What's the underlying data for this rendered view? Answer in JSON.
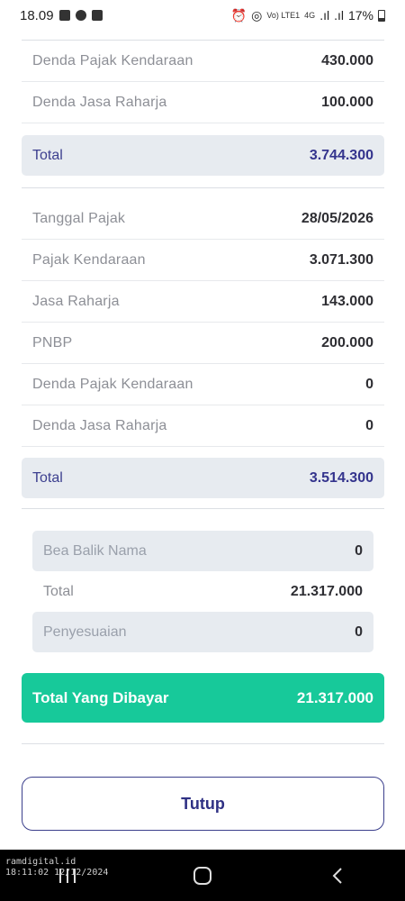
{
  "status_bar": {
    "time": "18.09",
    "network": "4G",
    "battery": "17%"
  },
  "section1": {
    "rows": [
      {
        "label": "Denda Pajak Kendaraan",
        "value": "430.000"
      },
      {
        "label": "Denda Jasa Raharja",
        "value": "100.000"
      }
    ],
    "total": {
      "label": "Total",
      "value": "3.744.300"
    }
  },
  "section2": {
    "rows": [
      {
        "label": "Tanggal Pajak",
        "value": "28/05/2026"
      },
      {
        "label": "Pajak Kendaraan",
        "value": "3.071.300"
      },
      {
        "label": "Jasa Raharja",
        "value": "143.000"
      },
      {
        "label": "PNBP",
        "value": "200.000"
      },
      {
        "label": "Denda Pajak Kendaraan",
        "value": "0"
      },
      {
        "label": "Denda Jasa Raharja",
        "value": "0"
      }
    ],
    "total": {
      "label": "Total",
      "value": "3.514.300"
    }
  },
  "summary": {
    "bea_balik_nama": {
      "label": "Bea Balik Nama",
      "value": "0"
    },
    "total": {
      "label": "Total",
      "value": "21.317.000"
    },
    "penyesuaian": {
      "label": "Penyesuaian",
      "value": "0"
    }
  },
  "grand_total": {
    "label": "Total Yang Dibayar",
    "value": "21.317.000"
  },
  "close_button": "Tutup",
  "watermark": {
    "line1": "ramdigital.id",
    "line2": "18:11:02 12/12/2024"
  },
  "colors": {
    "accent_green": "#17c99a",
    "accent_navy": "#34348d",
    "gray_box": "#e7ebf0"
  }
}
